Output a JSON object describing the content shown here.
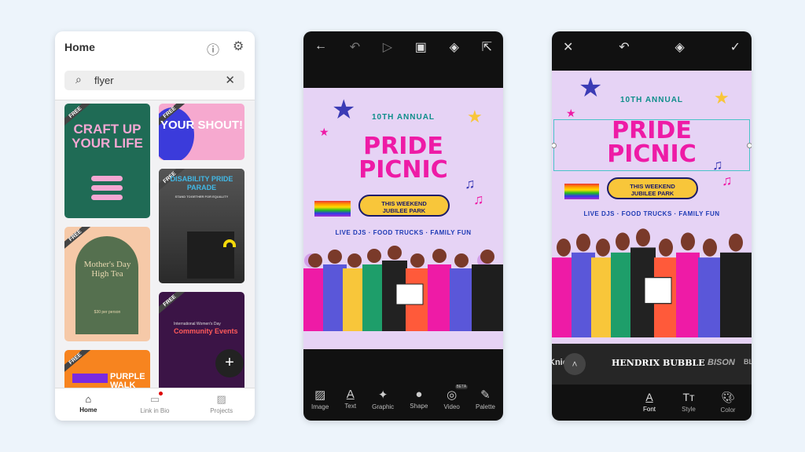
{
  "home": {
    "title": "Home",
    "search_value": "flyer",
    "nav": [
      {
        "label": "Home",
        "icon": "home-icon"
      },
      {
        "label": "Link in Bio",
        "icon": "browser-icon"
      },
      {
        "label": "Projects",
        "icon": "image-icon"
      }
    ],
    "free_label": "FREE",
    "templates": [
      {
        "title": "CRAFT UP YOUR LIFE",
        "bg": "#1f6b55",
        "fg": "#f4a7d3"
      },
      {
        "title": "YOUR SHOUT!",
        "bg": "#f6a9cf",
        "fg": "#ffffff"
      },
      {
        "title": "DISABILITY PRIDE PARADE",
        "subtitle": "STAND TOGETHER FOR EQUALITY",
        "bg": "#3a3a3a",
        "fg": "#41b8e6"
      },
      {
        "title": "Mother's Day High Tea",
        "subtitle": "$30 per person",
        "bg": "#f6c9a8",
        "fg": "#e8d8b0"
      },
      {
        "title": "Community Events",
        "subtitle": "International Women's Day",
        "bg": "#3b1446",
        "fg": "#ff5a5a"
      },
      {
        "title": "PURPLE WALK",
        "bg": "#f7841f",
        "fg": "#ffffff"
      }
    ]
  },
  "poster": {
    "annual": "10TH ANNUAL",
    "title1": "PRIDE",
    "title2": "PICNIC",
    "when": "THIS WEEKEND",
    "where": "JUBILEE PARK",
    "features": "LIVE DJS · FOOD TRUCKS · FAMILY FUN"
  },
  "editor": {
    "tools": [
      {
        "label": "Image",
        "icon": "image-icon"
      },
      {
        "label": "Text",
        "icon": "text-icon"
      },
      {
        "label": "Graphic",
        "icon": "graphic-icon"
      },
      {
        "label": "Shape",
        "icon": "shape-icon"
      },
      {
        "label": "Video",
        "icon": "video-icon"
      },
      {
        "label": "Palette",
        "icon": "palette-icon"
      }
    ],
    "beta": "BETA"
  },
  "text_editor": {
    "fonts": [
      "Knick",
      "Hendrix Bubble",
      "BISON",
      "BL"
    ],
    "selected_font": "HENDRIX BUBBLE",
    "tabs": [
      {
        "label": "Font"
      },
      {
        "label": "Style"
      },
      {
        "label": "Color"
      }
    ]
  }
}
